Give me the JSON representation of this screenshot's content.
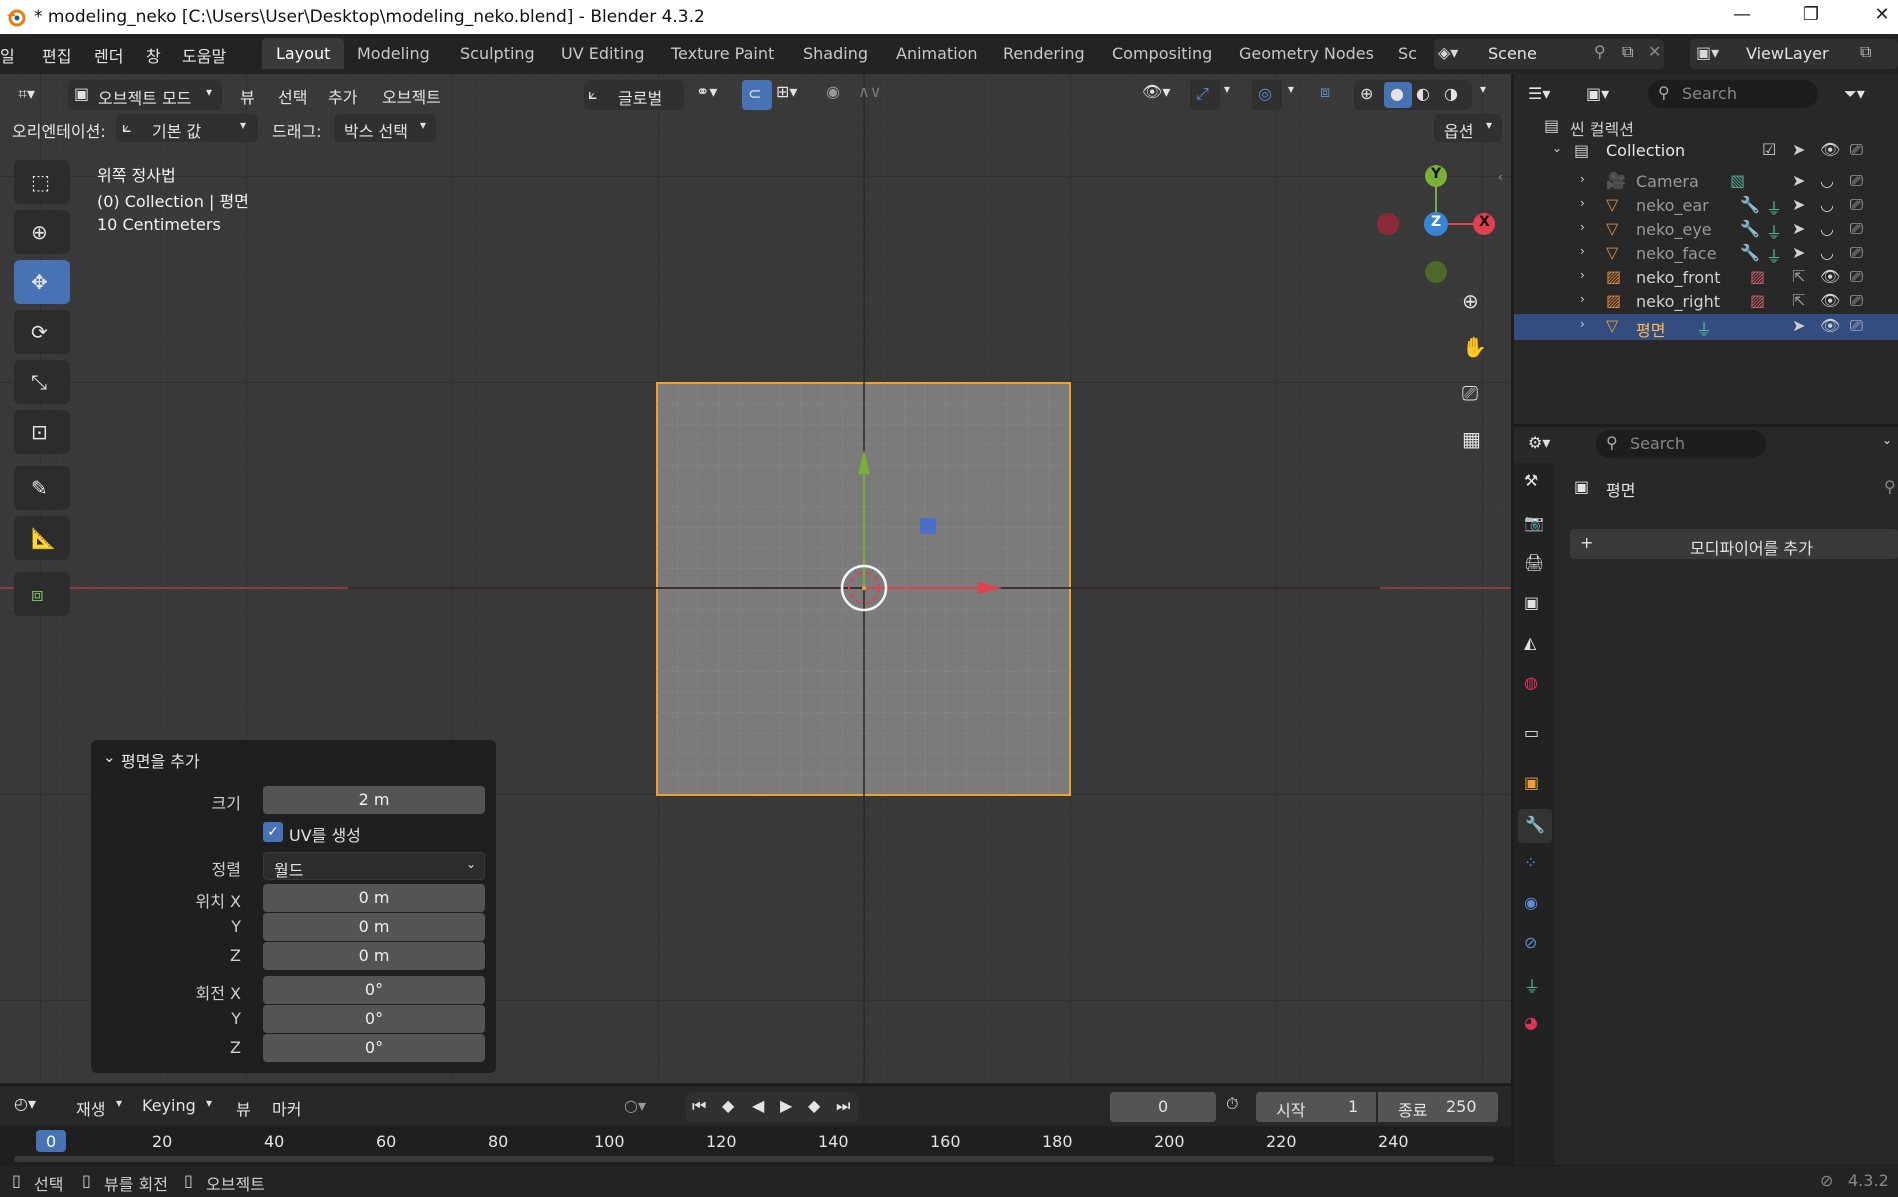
{
  "window": {
    "title": "* modeling_neko [C:\\Users\\User\\Desktop\\modeling_neko.blend] - Blender 4.3.2",
    "minimize": "—",
    "maximize": "❐",
    "close": "✕"
  },
  "menubar": {
    "items": [
      "일",
      "편집",
      "렌더",
      "창",
      "도움말"
    ],
    "workspaces": [
      "Layout",
      "Modeling",
      "Sculpting",
      "UV Editing",
      "Texture Paint",
      "Shading",
      "Animation",
      "Rendering",
      "Compositing",
      "Geometry Nodes",
      "Sc"
    ],
    "active_workspace": "Layout",
    "scene": "Scene",
    "view_layer": "ViewLayer"
  },
  "viewport_header": {
    "mode": "오브젝트 모드",
    "menus": [
      "뷰",
      "선택",
      "추가",
      "오브젝트"
    ],
    "transform_orientation": "글로벌",
    "orientation_label": "오리엔테이션:",
    "orientation_value": "기본 값",
    "drag_label": "드래그:",
    "drag_value": "박스 선택",
    "options": "옵션"
  },
  "viewport_overlay": {
    "view_name": "위쪽 정사법",
    "collection_info": "(0) Collection | 평면",
    "scale": "10 Centimeters"
  },
  "gizmo": {
    "y": "Y",
    "z": "Z",
    "x": "X"
  },
  "redo_panel": {
    "title": "평면을 추가",
    "size_label": "크기",
    "size_value": "2 m",
    "uv_label": "UV를 생성",
    "align_label": "정렬",
    "align_value": "월드",
    "loc_label": "위치 X",
    "loc_x": "0 m",
    "y_label": "Y",
    "loc_y": "0 m",
    "z_label": "Z",
    "loc_z": "0 m",
    "rot_label": "회전 X",
    "rot_x": "0°",
    "rot_y": "0°",
    "rot_z": "0°"
  },
  "outliner": {
    "search_placeholder": "Search",
    "scene_collection": "씬 컬렉션",
    "collection": "Collection",
    "items": [
      "Camera",
      "neko_ear",
      "neko_eye",
      "neko_face",
      "neko_front",
      "neko_right",
      "평면"
    ],
    "selected": "평면"
  },
  "properties": {
    "search_placeholder": "Search",
    "object_name": "평면",
    "add_modifier": "모디파이어를 추가"
  },
  "timeline": {
    "menus": [
      "재생",
      "Keying",
      "뷰",
      "마커"
    ],
    "current_frame": "0",
    "start_label": "시작",
    "start_value": "1",
    "end_label": "종료",
    "end_value": "250",
    "ruler": [
      "0",
      "20",
      "40",
      "60",
      "80",
      "100",
      "120",
      "140",
      "160",
      "180",
      "200",
      "220",
      "240"
    ]
  },
  "statusbar": {
    "select": "선택",
    "rotate_view": "뷰를 회전",
    "object": "오브젝트",
    "version": "4.3.2"
  },
  "colors": {
    "accent": "#4772b3",
    "selection_orange": "#f0a030",
    "x_axis": "#e04050",
    "y_axis": "#7ab03a",
    "z_axis": "#3a84d6"
  }
}
